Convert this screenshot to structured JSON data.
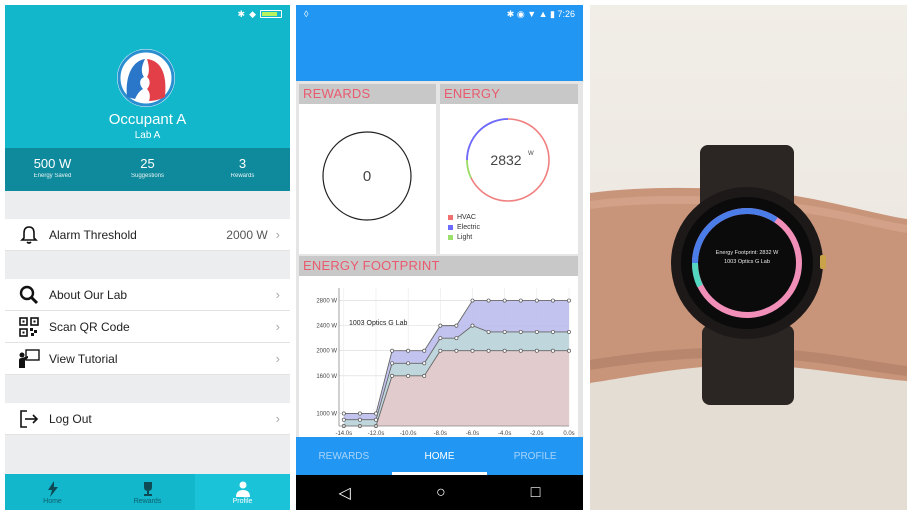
{
  "profile": {
    "name": "Occupant A",
    "lab": "Lab A",
    "stats": [
      {
        "value": "500 W",
        "label": "Energy Saved"
      },
      {
        "value": "25",
        "label": "Suggestions"
      },
      {
        "value": "3",
        "label": "Rewards"
      }
    ],
    "alarm": {
      "label": "Alarm Threshold",
      "value": "2000 W"
    },
    "menu": [
      {
        "label": "About Our Lab",
        "icon": "search-icon"
      },
      {
        "label": "Scan QR Code",
        "icon": "qr-code-icon"
      },
      {
        "label": "View Tutorial",
        "icon": "presenter-icon"
      }
    ],
    "logout": "Log Out",
    "tabs": [
      {
        "label": "Home",
        "icon": "lightning-icon"
      },
      {
        "label": "Rewards",
        "icon": "trophy-icon"
      },
      {
        "label": "Profile",
        "icon": "person-icon"
      }
    ],
    "colors": {
      "primary": "#12b7cc",
      "stats_bg": "#0f8a9c"
    }
  },
  "dashboard": {
    "status_time": "7:26",
    "rewards": {
      "header": "REWARDS",
      "value": "0"
    },
    "energy": {
      "header": "ENERGY",
      "value": "2832",
      "unit": "W",
      "legend": [
        {
          "label": "HVAC",
          "color": "#f07070"
        },
        {
          "label": "Electric",
          "color": "#6b6bff"
        },
        {
          "label": "Light",
          "color": "#9be06b"
        }
      ]
    },
    "footprint": {
      "header": "ENERGY FOOTPRINT",
      "annotation": "1003 Optics G Lab"
    },
    "tabs": [
      "REWARDS",
      "HOME",
      "PROFILE"
    ],
    "active_tab": "HOME",
    "colors": {
      "primary": "#2196f3",
      "accent": "#ea5a6e"
    }
  },
  "chart_data": {
    "type": "area",
    "title": "ENERGY FOOTPRINT",
    "annotation": "1003 Optics G Lab",
    "x_tick_labels": [
      "-14.0s",
      "-12.0s",
      "-10.0s",
      "-8.0s",
      "-6.0s",
      "-4.0s",
      "-2.0s",
      "0.0s"
    ],
    "y_tick_labels": [
      "1000 W",
      "1600 W",
      "2000 W",
      "2400 W",
      "2800 W"
    ],
    "x": [
      -14,
      -13,
      -12,
      -11,
      -10,
      -9,
      -8,
      -7,
      -6,
      -5,
      -4,
      -3,
      -2,
      -1,
      0
    ],
    "ylim": [
      800,
      3000
    ],
    "xlim": [
      -14.3,
      0
    ],
    "series": [
      {
        "name": "",
        "color": "#b8b8ec",
        "values": [
          1000,
          1000,
          1000,
          2000,
          2000,
          2000,
          2400,
          2400,
          2800,
          2800,
          2800,
          2800,
          2800,
          2800,
          2800
        ]
      },
      {
        "name": "",
        "color": "#bfd9d9",
        "values": [
          900,
          900,
          900,
          1800,
          1800,
          1800,
          2200,
          2200,
          2400,
          2300,
          2300,
          2300,
          2300,
          2300,
          2300
        ]
      },
      {
        "name": "",
        "color": "#e8c9c9",
        "values": [
          800,
          800,
          800,
          1600,
          1600,
          1600,
          2000,
          2000,
          2000,
          2000,
          2000,
          2000,
          2000,
          2000,
          2000
        ]
      }
    ],
    "grid": true
  },
  "watch": {
    "line1": "Energy Footprint: 2832 W",
    "line2": "1003 Optics G Lab"
  }
}
